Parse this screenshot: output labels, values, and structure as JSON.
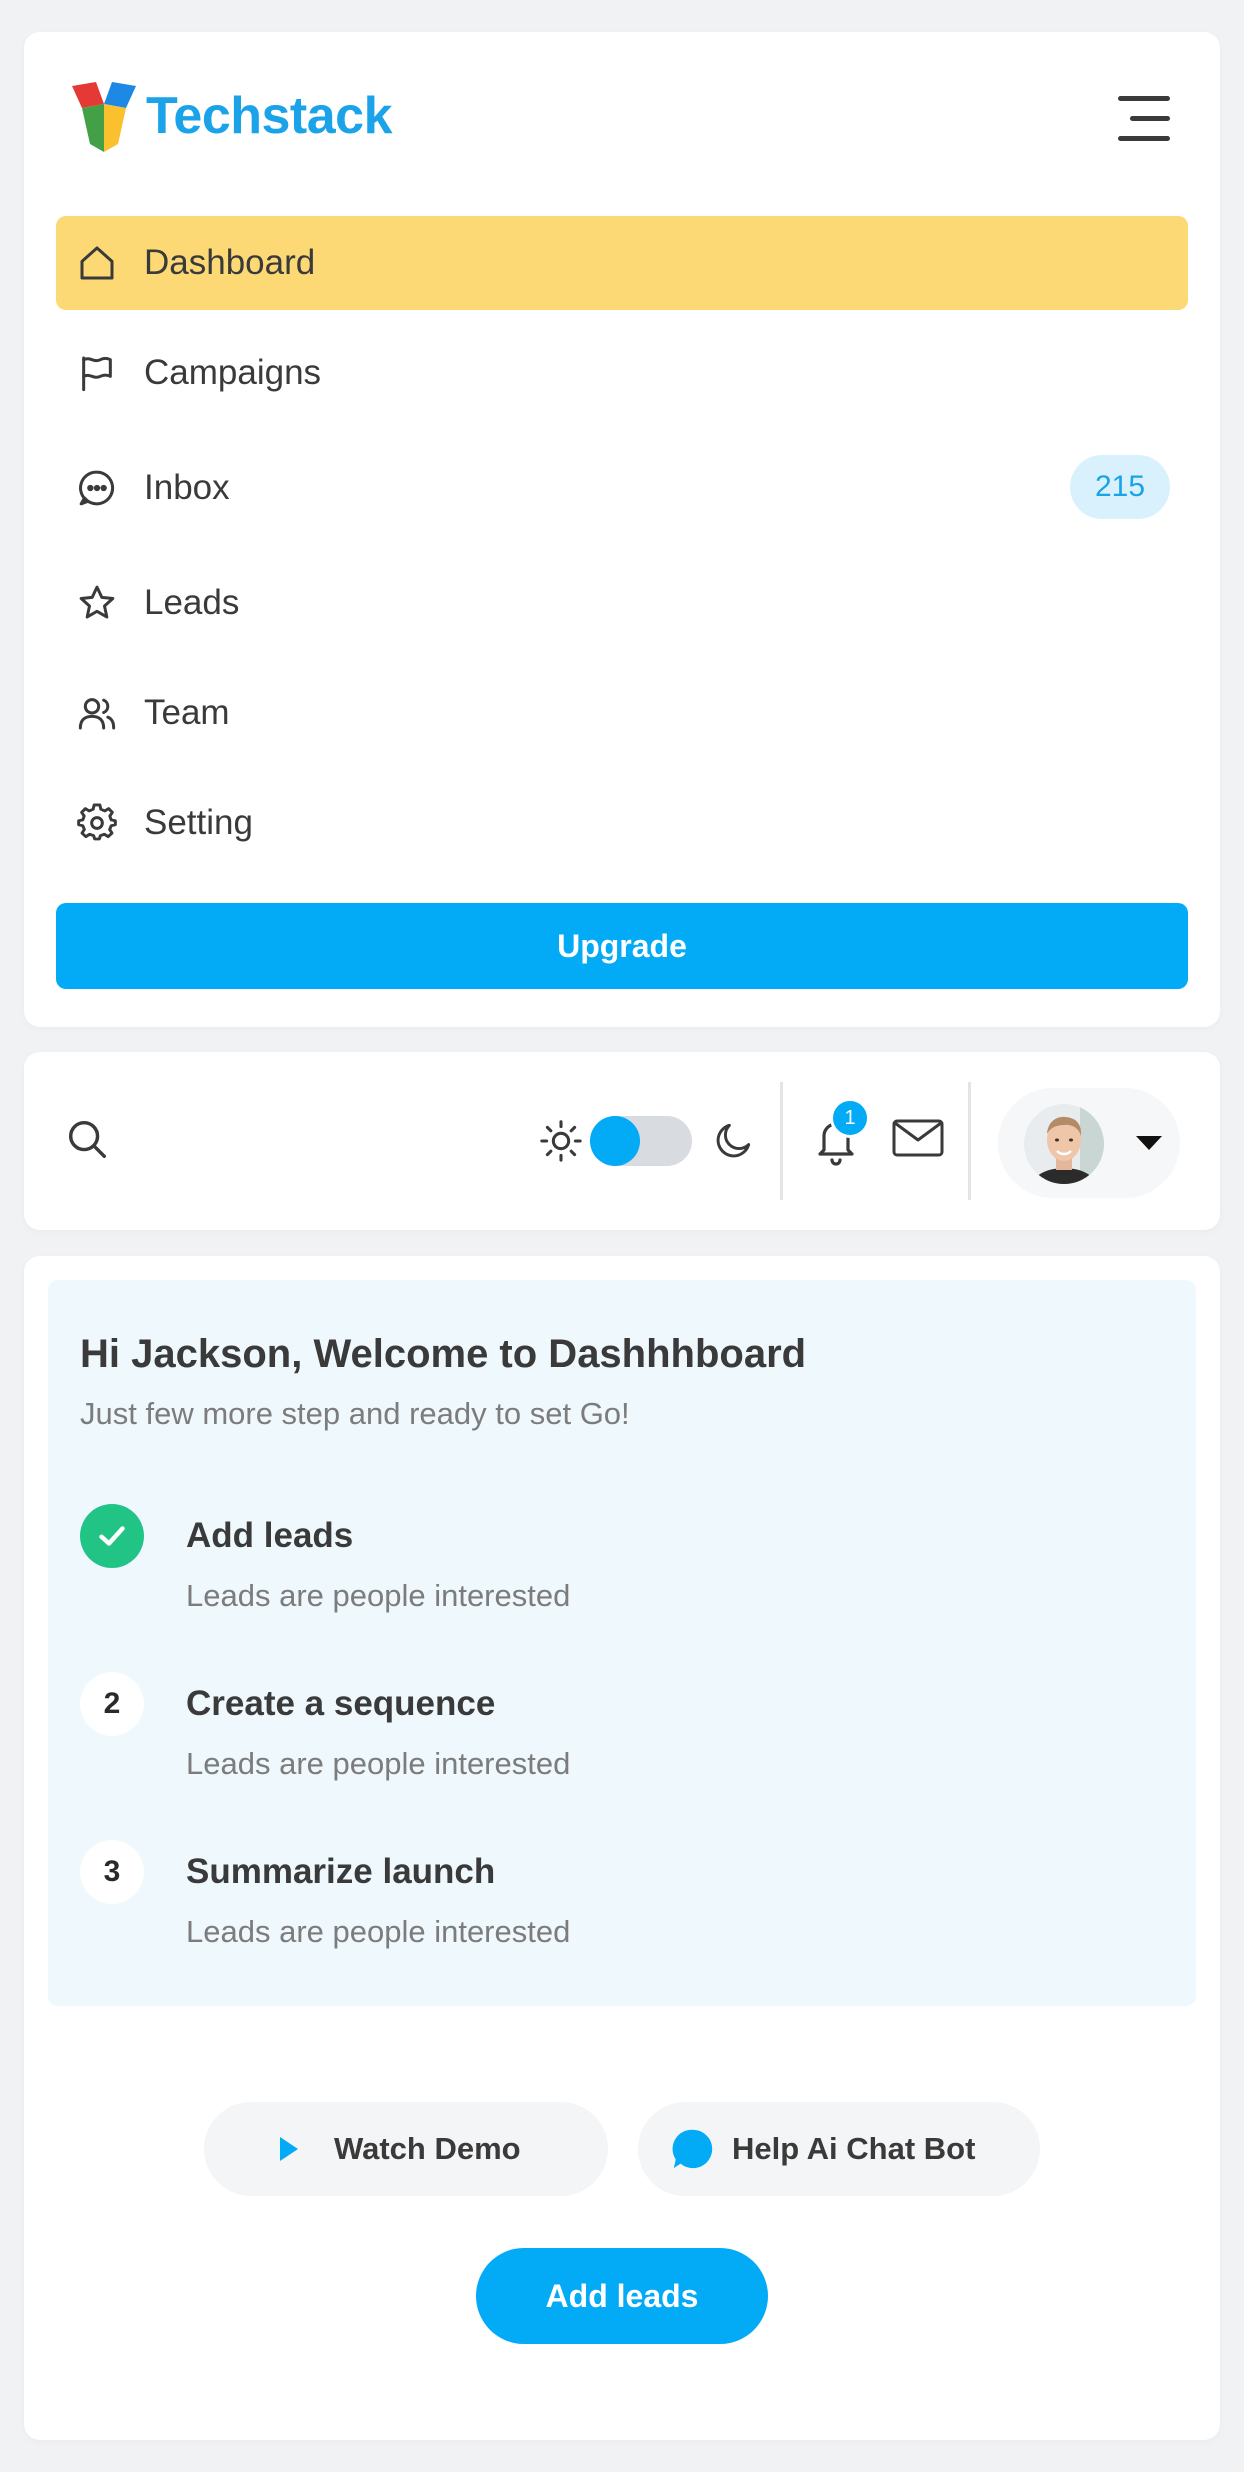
{
  "brand": {
    "name": "Techstack",
    "logo_icon": "techstack-logo",
    "color": "#1aa3e8"
  },
  "sidebar": {
    "menu_icon": "hamburger-icon",
    "items": [
      {
        "label": "Dashboard",
        "icon": "home-icon",
        "active": true
      },
      {
        "label": "Campaigns",
        "icon": "flag-icon"
      },
      {
        "label": "Inbox",
        "icon": "chat-icon",
        "badge": "215"
      },
      {
        "label": "Leads",
        "icon": "star-icon"
      },
      {
        "label": "Team",
        "icon": "users-icon"
      },
      {
        "label": "Setting",
        "icon": "gear-icon"
      }
    ],
    "upgrade_label": "Upgrade"
  },
  "toolbar": {
    "search_icon": "search-icon",
    "theme_toggle": {
      "mode": "light"
    },
    "notifications_count": "1",
    "mail_icon": "mail-icon"
  },
  "welcome": {
    "title": "Hi Jackson, Welcome to Dashhhboard",
    "subtitle": "Just few more step and ready to set Go!",
    "steps": [
      {
        "number": "1",
        "title": "Add leads",
        "desc": "Leads are people interested",
        "done": true
      },
      {
        "number": "2",
        "title": "Create a sequence",
        "desc": "Leads are people interested",
        "done": false
      },
      {
        "number": "3",
        "title": "Summarize launch",
        "desc": "Leads are people interested",
        "done": false
      }
    ],
    "watch_demo_label": "Watch Demo",
    "help_bot_label": "Help Ai Chat Bot",
    "add_leads_label": "Add leads"
  },
  "colors": {
    "accent": "#03aaf6",
    "active_nav": "#fcd975",
    "success": "#22c486",
    "welcome_bg": "#eef8fd"
  }
}
